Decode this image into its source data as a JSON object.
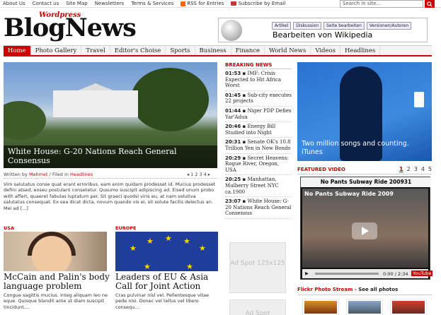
{
  "topbar": {
    "links": [
      "About Us",
      "Contact us",
      "Site Map",
      "Newsletters",
      "Terms & Services"
    ],
    "rss_label": "RSS for Entries",
    "subscribe_label": "Subscribe by Email",
    "search_placeholder": "Search in site..."
  },
  "logo": {
    "text": "BlogNews",
    "tag": "Wordpress"
  },
  "banner": {
    "tabs": [
      "Artikel",
      "Diskussion",
      "Seite bearbeiten",
      "Versionen/Autoren"
    ],
    "text": "Bearbeiten von Wikipedia"
  },
  "nav": [
    "Home",
    "Photo Gallery",
    "Travel",
    "Editor's Choise",
    "Sports",
    "Business",
    "Finance",
    "World News",
    "Videos",
    "Headlines"
  ],
  "featured": {
    "caption": "White House: G-20 Nations Reach General Consensus",
    "byline_prefix": "Written by",
    "author": "Mehmet",
    "filed": "/ Filed in",
    "category": "Headlines",
    "pages": [
      "1",
      "2",
      "3",
      "4"
    ],
    "summary": "Vim salutatus conse quat erant erroribus, eam enim quidam prodesset id. Mucius prodesset defini atsed, eoseu postulant consetetur. Qusumo suscipit adipiscing ad. Eised unum probo with affert, quaeret fabulas luptatum per. Sit graeci quodsi viris eu, at nam solutiva salutatus consequat. Ex sea dicat dicta, novum quando vis ei, sit solute facilis delectus an. Mei ad [...]"
  },
  "usa": {
    "label": "USA",
    "title": "McCain and Palin's body language problem",
    "text": "Congue sagittis mucius. Integ aliquam leo ne eque. Quisque blandit ante ut diam suscipit tincidunt...."
  },
  "europe": {
    "label": "EUROPE",
    "title": "Leaders of EU & Asia Call for Joint Action",
    "text": "Cras pulvinar nisl vel. Pellentesque vitae pede nisi. Donec vel tellus vel libero consequ..."
  },
  "breaking": {
    "heading": "BREAKING NEWS",
    "items": [
      {
        "time": "01:53",
        "text": "IMF: Crisis Expected to Hit Africa Worst"
      },
      {
        "time": "01:45",
        "text": "Sub-city executes 22 projects"
      },
      {
        "time": "01:44",
        "text": "Niger PDP Defies Yar'Adua"
      },
      {
        "time": "20:46",
        "text": "Energy Bill Studied into Night"
      },
      {
        "time": "20:31",
        "text": "Senate OK's 10.8 Trillion Yen in New Bonds"
      },
      {
        "time": "20:29",
        "text": "Secret Heavens: Rogue River, Oregon, USA"
      },
      {
        "time": "20:25",
        "text": "Manhattan, Mulberry Street NYC ca.1900"
      },
      {
        "time": "23:07",
        "text": "White House: G-20 Nations Reach General Consensus"
      }
    ]
  },
  "ads": {
    "label1": "Ad Spot 125x125",
    "label2": "Ad Spot"
  },
  "itunes": {
    "text": "Two million songs and counting.",
    "brand": "iTunes"
  },
  "featured_video": {
    "heading": "FEATURED VIDEO",
    "pages": [
      "1",
      "2",
      "3",
      "4",
      "5"
    ],
    "title": "No Pants Subway Ride 200931",
    "screen_title": "No Pants Subway Ride 2009",
    "time": "0:00 / 2:34",
    "brand": "YouTube"
  },
  "flickr": {
    "heading": "Flickr Photo Stream",
    "link": "See all photos"
  },
  "colors": {
    "accent": "#cc0000",
    "nav_bg": "#f4f4f4"
  }
}
